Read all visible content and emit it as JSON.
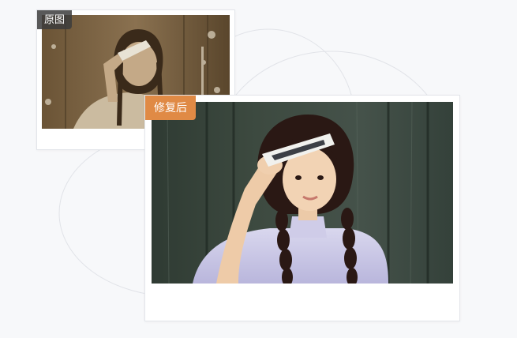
{
  "original": {
    "label": "原图",
    "label_color": "#3c3c3c"
  },
  "restored": {
    "label": "修复后",
    "label_color": "#e08a45"
  },
  "colors": {
    "background": "#f7f8fa",
    "card_border": "#e3e5ea",
    "deco_line": "#e1e3e8"
  },
  "images": {
    "original": "sepia-tone-damaged-portrait",
    "restored": "colorized-restored-portrait"
  }
}
